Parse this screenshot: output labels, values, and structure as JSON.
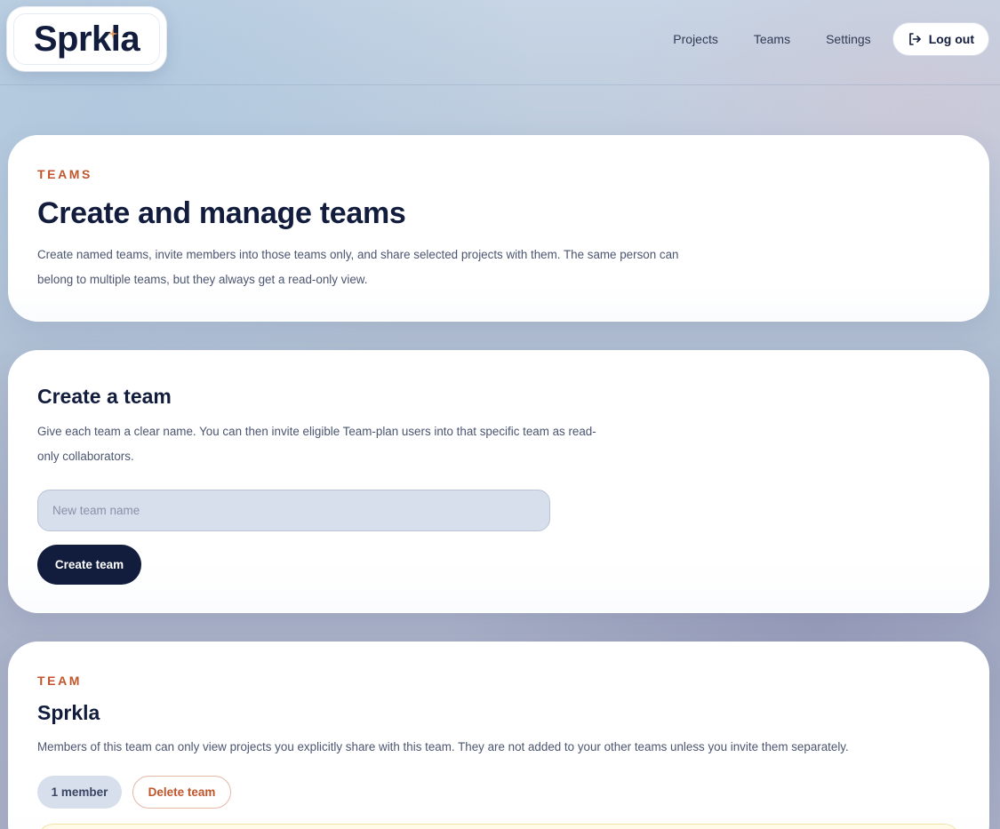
{
  "header": {
    "logo_text": "Sprkla",
    "nav": {
      "projects": "Projects",
      "teams": "Teams",
      "settings": "Settings",
      "logout": "Log out"
    }
  },
  "intro": {
    "eyebrow": "TEAMS",
    "title": "Create and manage teams",
    "desc_line1": "Create named teams, invite members into those teams only, and share selected projects with them. The same person can",
    "desc_line2": "belong to multiple teams, but they always get a read-only view."
  },
  "create_team": {
    "title": "Create a team",
    "desc_line1": "Give each team a clear name. You can then invite eligible Team-plan users into that specific team as read-",
    "desc_line2": "only collaborators.",
    "input_value": "",
    "input_placeholder": "New team name",
    "button_label": "Create team"
  },
  "team": {
    "eyebrow": "TEAM",
    "name": "Sprkla",
    "desc": "Members of this team can only view projects you explicitly share with this team. They are not added to your other teams unless you invite them separately.",
    "member_count": "1 member",
    "delete_label": "Delete team"
  },
  "colors": {
    "navy": "#121c3d",
    "accent": "#c0552c",
    "input_bg": "#d8dfec"
  }
}
